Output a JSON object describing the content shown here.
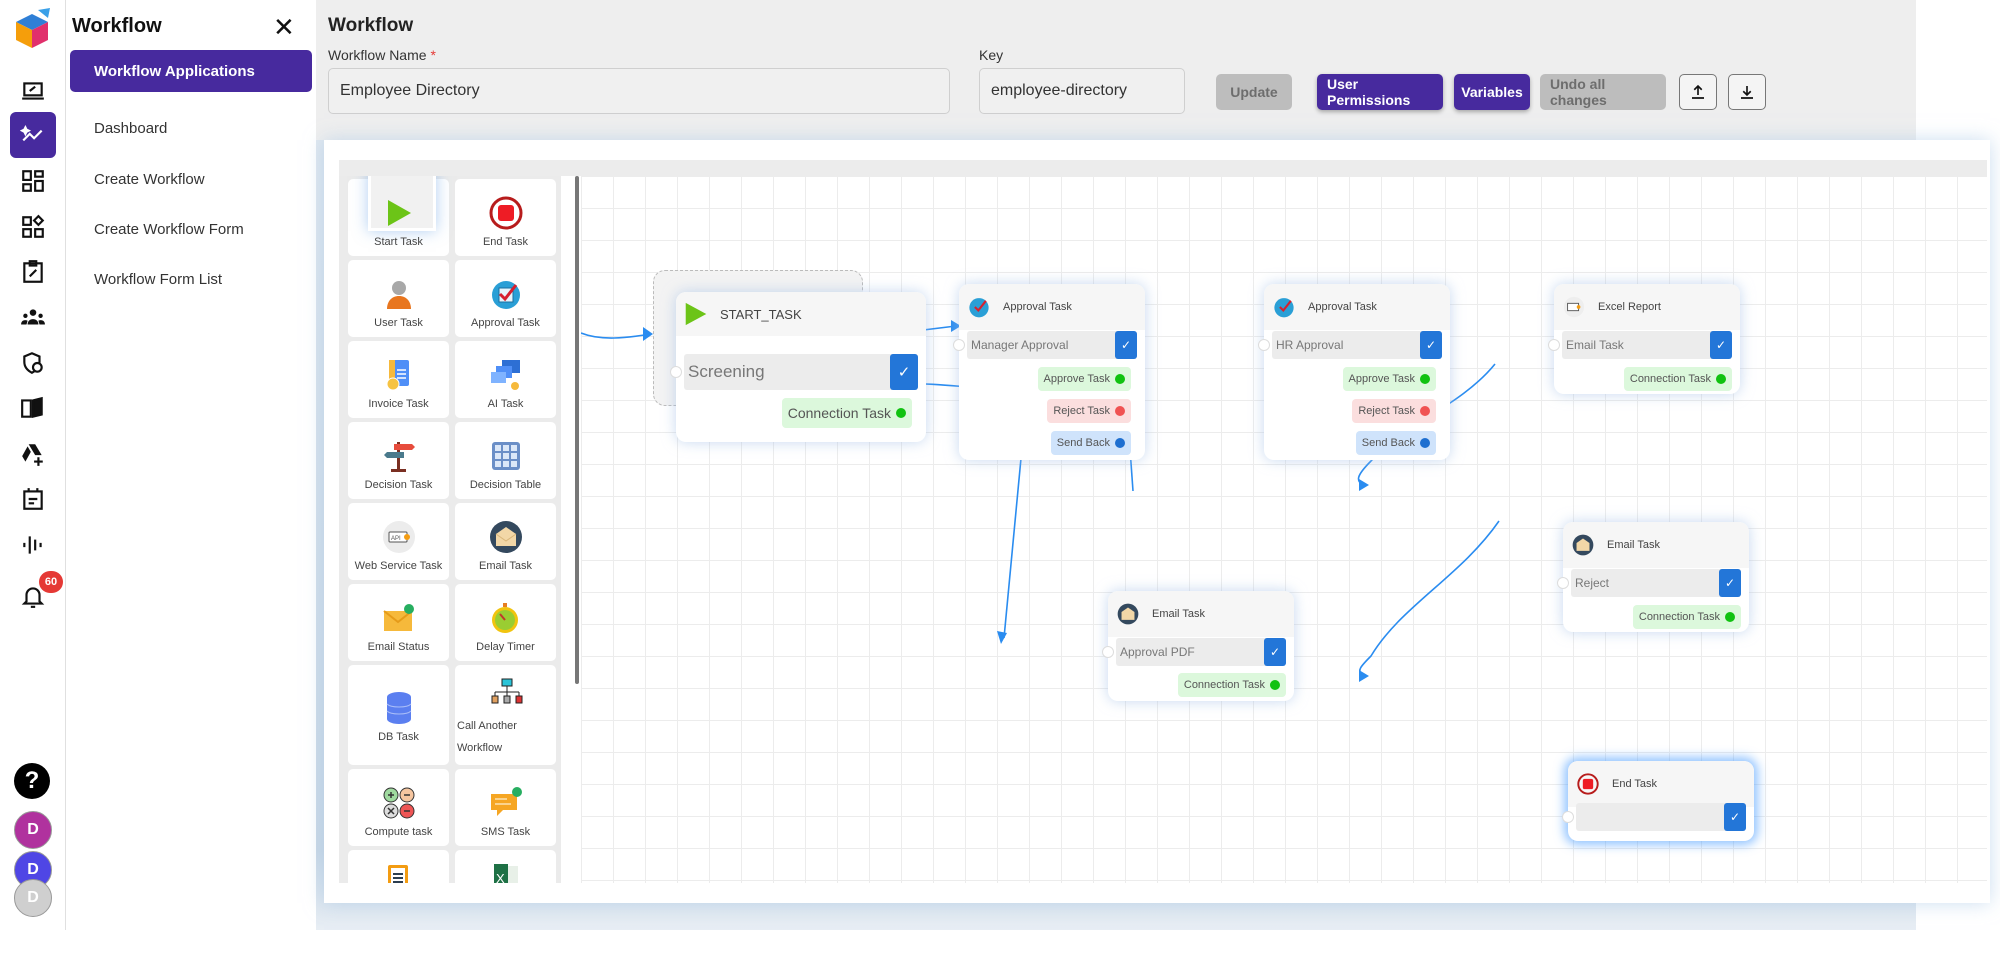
{
  "rail": {
    "items": [
      {
        "name": "presentation-icon",
        "active": false
      },
      {
        "name": "workflow-icon",
        "active": true
      },
      {
        "name": "dashboard-grid-icon",
        "active": false
      },
      {
        "name": "widgets-icon",
        "active": false
      },
      {
        "name": "clipboard-edit-icon",
        "active": false
      },
      {
        "name": "users-group-icon",
        "active": false
      },
      {
        "name": "shield-user-icon",
        "active": false
      },
      {
        "name": "book-icon",
        "active": false
      },
      {
        "name": "drive-add-icon",
        "active": false
      },
      {
        "name": "calendar-icon",
        "active": false
      },
      {
        "name": "audio-wave-icon",
        "active": false
      },
      {
        "name": "bell-icon",
        "active": false
      }
    ],
    "notification_count": "60",
    "help_label": "?",
    "avatars": [
      {
        "initial": "D",
        "color": "#b0329e"
      },
      {
        "initial": "D",
        "color": "#4f46e5"
      },
      {
        "initial": "D",
        "color": "#cfcfcf"
      }
    ]
  },
  "subnav": {
    "title": "Workflow",
    "close_label": "✕",
    "items": [
      {
        "label": "Workflow Applications",
        "active": true
      },
      {
        "label": "Dashboard",
        "active": false
      },
      {
        "label": "Create Workflow",
        "active": false
      },
      {
        "label": "Create Workflow Form",
        "active": false
      },
      {
        "label": "Workflow Form List",
        "active": false
      }
    ]
  },
  "header": {
    "title": "Workflow",
    "workflow_name_label": "Workflow Name",
    "required_mark": "*",
    "workflow_name_value": "Employee Directory",
    "key_label": "Key",
    "key_value": "employee-directory",
    "buttons": {
      "update": "Update",
      "user_permissions": "User Permissions",
      "variables": "Variables",
      "undo": "Undo all changes",
      "upload": "⭱",
      "download": "⭳"
    }
  },
  "palette": {
    "tools": [
      {
        "label": "Start Task",
        "icon": "start-icon"
      },
      {
        "label": "End Task",
        "icon": "end-icon"
      },
      {
        "label": "User Task",
        "icon": "user-icon"
      },
      {
        "label": "Approval Task",
        "icon": "approval-icon"
      },
      {
        "label": "Invoice Task",
        "icon": "invoice-icon"
      },
      {
        "label": "AI Task",
        "icon": "ai-icon"
      },
      {
        "label": "Decision Task",
        "icon": "signpost-icon"
      },
      {
        "label": "Decision Table",
        "icon": "table-icon"
      },
      {
        "label": "Web Service Task",
        "icon": "api-icon"
      },
      {
        "label": "Email Task",
        "icon": "email-icon"
      },
      {
        "label": "Email Status",
        "icon": "email-status-icon"
      },
      {
        "label": "Delay Timer",
        "icon": "timer-icon"
      },
      {
        "label": "DB Task",
        "icon": "database-icon"
      },
      {
        "label": "Call Another Workflow",
        "icon": "hierarchy-icon"
      },
      {
        "label": "Compute task",
        "icon": "calculator-icon"
      },
      {
        "label": "SMS Task",
        "icon": "sms-icon"
      },
      {
        "label": "",
        "icon": "form-icon"
      },
      {
        "label": "",
        "icon": "excel-icon"
      }
    ]
  },
  "nodes": {
    "start": {
      "title": "START_TASK",
      "field": "Screening",
      "outputs": [
        "Connection Task"
      ]
    },
    "manager_approval": {
      "title": "Approval Task",
      "field": "Manager Approval",
      "outputs": [
        "Approve Task",
        "Reject Task",
        "Send Back"
      ]
    },
    "hr_approval": {
      "title": "Approval Task",
      "field": "HR Approval",
      "outputs": [
        "Approve Task",
        "Reject Task",
        "Send Back"
      ]
    },
    "excel_report": {
      "title": "Excel Report",
      "field": "Email Task",
      "outputs": [
        "Connection Task"
      ]
    },
    "email_approval_pdf": {
      "title": "Email Task",
      "field": "Approval PDF",
      "outputs": [
        "Connection Task"
      ]
    },
    "email_reject": {
      "title": "Email Task",
      "field": "Reject",
      "outputs": [
        "Connection Task"
      ]
    },
    "end": {
      "title": "End Task",
      "field": ""
    }
  },
  "check_glyph": "✓"
}
